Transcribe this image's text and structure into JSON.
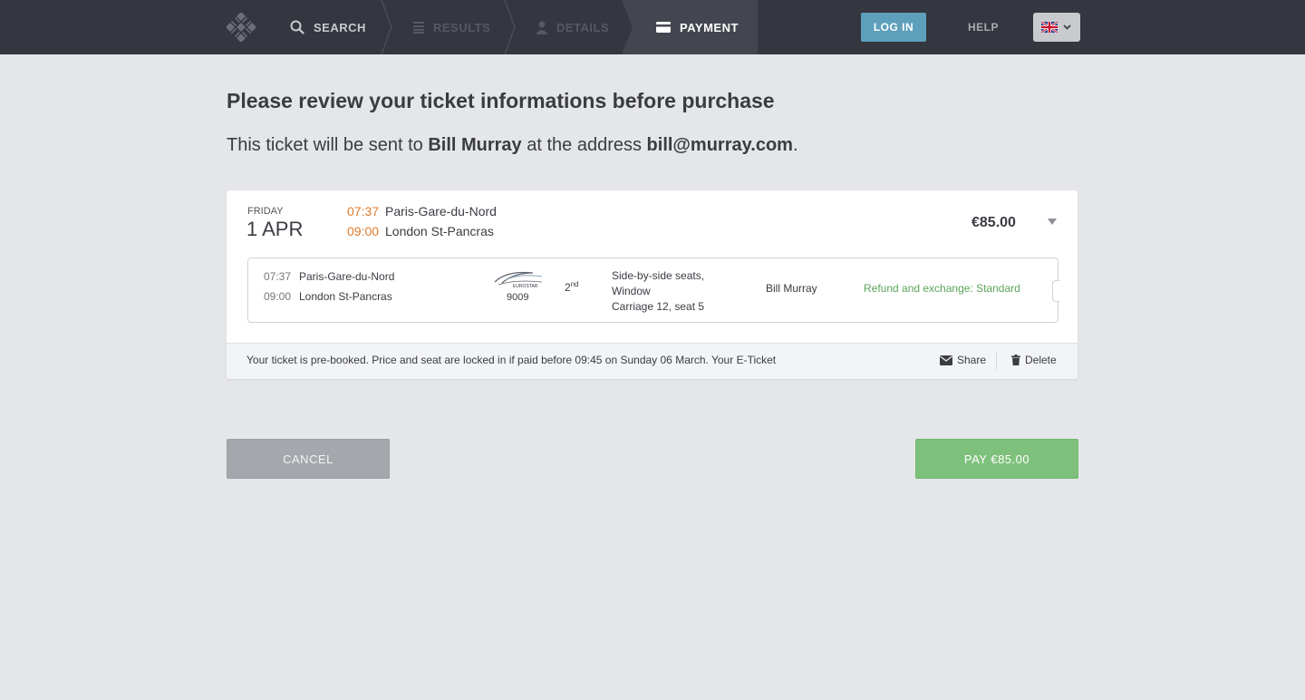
{
  "nav": {
    "steps": [
      {
        "label": "SEARCH",
        "icon": "search-icon",
        "state": "done"
      },
      {
        "label": "RESULTS",
        "icon": "list-icon",
        "state": "disabled"
      },
      {
        "label": "DETAILS",
        "icon": "user-icon",
        "state": "disabled"
      },
      {
        "label": "PAYMENT",
        "icon": "card-icon",
        "state": "active"
      }
    ],
    "login_label": "LOG IN",
    "help_label": "HELP",
    "language_icon": "uk-flag-icon"
  },
  "review": {
    "title": "Please review your ticket informations before purchase",
    "sent_prefix": "This ticket will be sent to ",
    "recipient_name": "Bill Murray",
    "address_prefix": " at the address ",
    "recipient_email": "bill@murray.com",
    "sent_suffix": "."
  },
  "ticket": {
    "day_name": "FRIDAY",
    "date": "1 APR",
    "departure_time": "07:37",
    "departure_station": "Paris-Gare-du-Nord",
    "arrival_time": "09:00",
    "arrival_station": "London St-Pancras",
    "price": "€85.00",
    "segment": {
      "departure_time": "07:37",
      "departure_station": "Paris-Gare-du-Nord",
      "arrival_time": "09:00",
      "arrival_station": "London St-Pancras",
      "operator": "EUROSTAR",
      "train_number": "9009",
      "class_number": "2",
      "class_suffix": "nd",
      "seat_line1": "Side-by-side seats,",
      "seat_line2": "Window",
      "seat_line3": "Carriage 12, seat 5",
      "passenger": "Bill Murray",
      "refund": "Refund and exchange: Standard"
    },
    "notice": "Your ticket is pre-booked. Price and seat are locked in if paid before 09:45 on Sunday 06 March. Your E-Ticket",
    "share_label": "Share",
    "delete_label": "Delete"
  },
  "actions": {
    "cancel_label": "CANCEL",
    "pay_label": "PAY €85.00"
  },
  "colors": {
    "topbar": "#34373f",
    "accent_orange": "#e07b2b",
    "refund_green": "#5aa55a",
    "pay_green": "#7ec17c",
    "login_blue": "#5e9fbc"
  }
}
